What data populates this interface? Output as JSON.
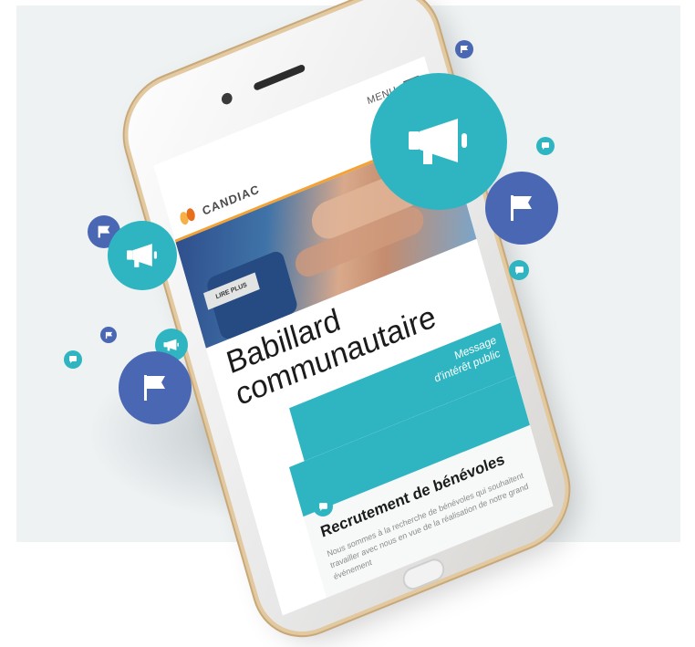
{
  "app": {
    "brand": "CANDIAC",
    "menu_label": "MENU"
  },
  "page": {
    "title_line1": "Babillard",
    "title_line2": "communautaire",
    "banner_line1": "Message",
    "banner_line2": "d'intérêt public"
  },
  "card": {
    "title": "Recrutement de bénévoles",
    "body": "Nous sommes à la recherche de bénévoles qui souhaitent travailler avec nous en vue de la réalisation de notre grand événement",
    "read_more": "LIRE PLUS"
  },
  "icons": {
    "megaphone": "megaphone-icon",
    "flag": "flag-icon",
    "chat": "chat-icon",
    "menu": "hamburger-icon"
  },
  "colors": {
    "teal": "#2fb5c1",
    "blue": "#4a67b4",
    "orange": "#f3a233",
    "background": "#eef2f3"
  }
}
